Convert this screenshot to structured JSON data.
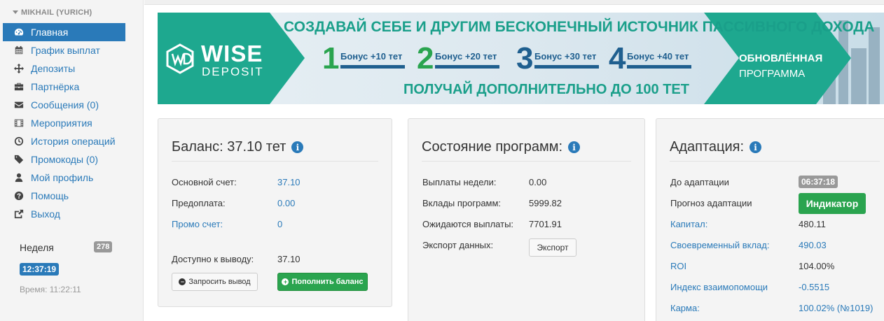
{
  "sidebar": {
    "user": "MIKHAIL (YURICH)",
    "items": [
      {
        "label": "Главная",
        "icon": "dashboard-icon"
      },
      {
        "label": "График выплат",
        "icon": "calendar-icon"
      },
      {
        "label": "Депозиты",
        "icon": "move-arrows-icon"
      },
      {
        "label": "Партнёрка",
        "icon": "briefcase-icon"
      },
      {
        "label": "Сообщения (0)",
        "icon": "envelope-icon"
      },
      {
        "label": "Мероприятия",
        "icon": "film-icon"
      },
      {
        "label": "История операций",
        "icon": "clock-icon"
      },
      {
        "label": "Промокоды (0)",
        "icon": "tag-icon"
      },
      {
        "label": "Мой профиль",
        "icon": "user-icon"
      },
      {
        "label": "Помощь",
        "icon": "question-icon"
      },
      {
        "label": "Выход",
        "icon": "exit-icon"
      }
    ],
    "week_label": "Неделя",
    "week_value": "278",
    "clock": "12:37:19",
    "time_text": "Время: 11:22:11"
  },
  "banner": {
    "logo_top": "WISE",
    "logo_bottom": "DEPOSIT",
    "headline": "СОЗДАВАЙ СЕБЕ И ДРУГИМ БЕСКОНЕЧНЫЙ ИСТОЧНИК ПАССИВНОГО ДОХОДА",
    "steps": [
      {
        "num": "1",
        "label": "Бонус +10 тет"
      },
      {
        "num": "2",
        "label": "Бонус +20 тет"
      },
      {
        "num": "3",
        "label": "Бонус +30 тет"
      },
      {
        "num": "4",
        "label": "Бонус +40 тет"
      }
    ],
    "subline": "ПОЛУЧАЙ ДОПОЛНИТЕЛЬНО ДО 100 ТЕТ",
    "program_title": "ОБНОВЛЁННАЯ",
    "program_sub": "ПРОГРАММА",
    "colors": {
      "teal": "#1ea88f",
      "green_num": "#2aa44f",
      "blue_num": "#1f5f8f"
    }
  },
  "balance": {
    "title": "Баланс: 37.10 тет",
    "main_label": "Основной счет:",
    "main_value": "37.10",
    "prepay_label": "Предоплата:",
    "prepay_value": "0.00",
    "promo_label": "Промо счет:",
    "promo_value": "0",
    "avail_label": "Доступно к выводу:",
    "avail_value": "37.10",
    "withdraw_btn": "Запросить вывод",
    "topup_btn": "Пополнить баланс"
  },
  "programs": {
    "title": "Состояние программ:",
    "rows": [
      {
        "label": "Выплаты недели:",
        "value": "0.00"
      },
      {
        "label": "Вклады программ:",
        "value": "5999.82"
      },
      {
        "label": "Ожидаются выплаты:",
        "value": "7701.91"
      }
    ],
    "export_label": "Экспорт данных:",
    "export_btn": "Экспорт"
  },
  "adaptation": {
    "title": "Адаптация:",
    "until_label": "До адаптации",
    "until_value": "06:37:18",
    "forecast_label": "Прогноз адаптации",
    "forecast_btn": "Индикатор",
    "rows": [
      {
        "label": "Капитал:",
        "value": "480.11"
      },
      {
        "label": "Своевременный вклад:",
        "value": "490.03"
      },
      {
        "label": "ROI",
        "value": "104.00%"
      },
      {
        "label": "Индекс взаимопомощи",
        "value": "-0.5515"
      },
      {
        "label": "Карма:",
        "value": "100.02% (№1019)"
      }
    ]
  }
}
